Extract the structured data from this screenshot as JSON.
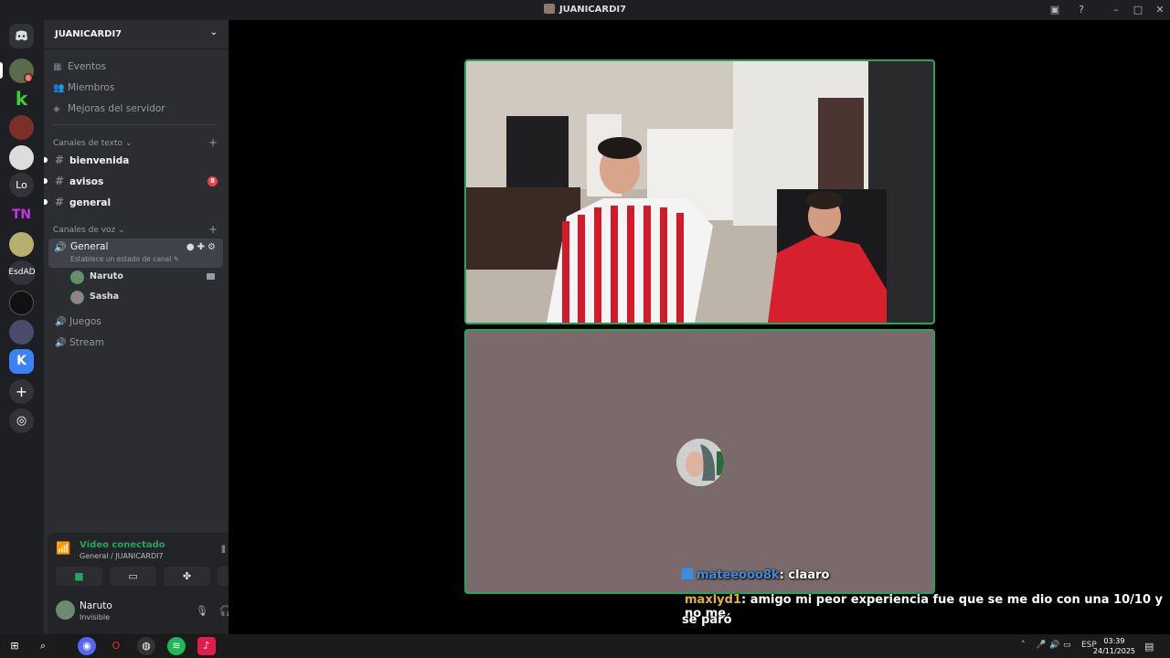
{
  "window": {
    "title": "JUANICARDI7"
  },
  "rail": {
    "text_servers": [
      "Lo",
      "EsdAD"
    ],
    "badge": "8"
  },
  "sidebar": {
    "server_name": "JUANICARDI7",
    "nav": [
      {
        "label": "Eventos",
        "icon": "calendar-icon"
      },
      {
        "label": "Miembros",
        "icon": "members-icon"
      },
      {
        "label": "Mejoras del servidor",
        "icon": "boost-icon"
      }
    ],
    "text_category": "Canales de texto",
    "text_channels": [
      {
        "name": "bienvenida",
        "unread": true
      },
      {
        "name": "avisos",
        "unread": true,
        "mentions": "8"
      },
      {
        "name": "general",
        "unread": true
      }
    ],
    "voice_category": "Canales de voz",
    "voice_channels": {
      "active": {
        "name": "General",
        "status": "Establece un estado de canal"
      },
      "users": [
        "Naruto",
        "Sasha"
      ],
      "others": [
        "Juegos",
        "Stream"
      ]
    }
  },
  "voice_panel": {
    "title": "Vídeo conectado",
    "subtitle": "General / JUANICARDI7"
  },
  "user_panel": {
    "name": "Naruto",
    "status": "Invisible"
  },
  "chat": {
    "line1_user": "mateeooo8k",
    "line1_text": ": claaro",
    "line2_user": "maxlyd1",
    "line2_text": ": amigo mi peor experiencia fue que se me dio con una 10/10 y no me",
    "line3_text": "se paró"
  },
  "taskbar": {
    "lang": "ESP",
    "time": "03:39",
    "date": "24/11/2025"
  },
  "colors": {
    "accent_green": "#23a55a",
    "mention_red": "#f23f43",
    "blurple": "#5865f2"
  }
}
